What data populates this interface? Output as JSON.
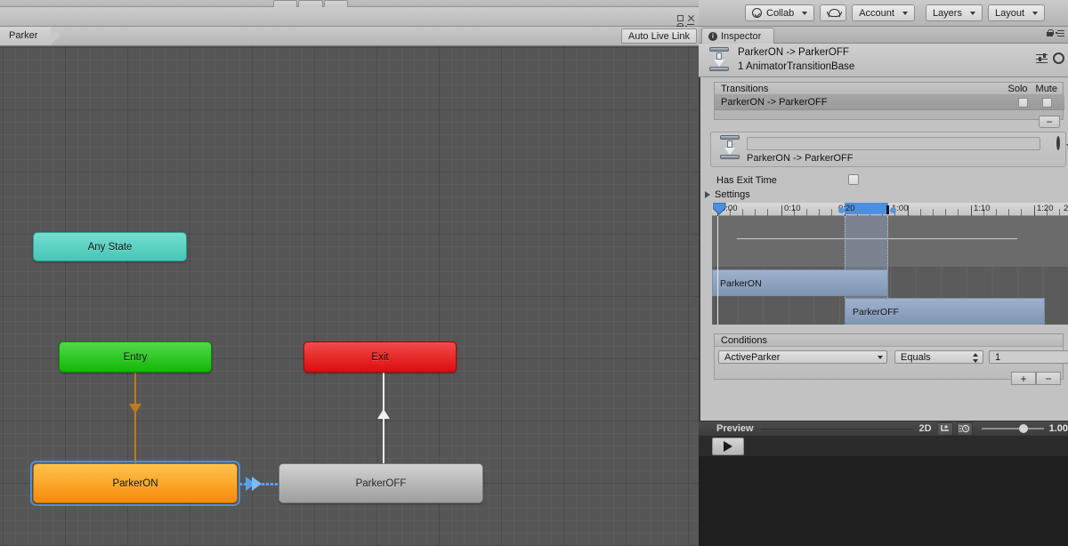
{
  "animator": {
    "breadcrumb": "Parker",
    "auto_live_link": "Auto Live Link",
    "nodes": [
      {
        "name": "Any State",
        "type": "any-state"
      },
      {
        "name": "Entry",
        "type": "entry"
      },
      {
        "name": "Exit",
        "type": "exit"
      },
      {
        "name": "ParkerON",
        "type": "state",
        "selected": true
      },
      {
        "name": "ParkerOFF",
        "type": "state",
        "selected": false
      }
    ],
    "colors": {
      "any_state": "#45c6b6",
      "entry": "#12b806",
      "exit": "#dd0d0d",
      "parker_on": "#f58b09",
      "parker_off": "#9e9e9e",
      "selection": "#4d90dd",
      "transition_link": "#5aa2e8",
      "canvas": "#565656"
    }
  },
  "toolbar": {
    "collab": "Collab",
    "cloud_icon": "cloud-icon",
    "account": "Account",
    "layers": "Layers",
    "layout": "Layout"
  },
  "inspector": {
    "tab": "Inspector",
    "object_title": "ParkerON -> ParkerOFF",
    "object_subtitle": "1 AnimatorTransitionBase",
    "transitions": {
      "header": "Transitions",
      "solo": "Solo",
      "mute": "Mute",
      "rows": [
        {
          "label": "ParkerON -> ParkerOFF",
          "solo": false,
          "mute": false
        }
      ],
      "remove_label": "−"
    },
    "transition_detail": {
      "name_value": "",
      "name_placeholder": "",
      "sub_label": "ParkerON -> ParkerOFF"
    },
    "has_exit_time": {
      "label": "Has Exit Time",
      "checked": false
    },
    "settings_foldout": "Settings",
    "timeline": {
      "ticks": [
        "0:00",
        "0:10",
        "0:20",
        "1:00",
        "1:10",
        "1:20",
        "2"
      ],
      "clips": [
        {
          "label": "ParkerON"
        },
        {
          "label": "ParkerOFF"
        }
      ]
    },
    "conditions": {
      "header": "Conditions",
      "rows": [
        {
          "parameter": "ActiveParker",
          "operator": "Equals",
          "value": "1"
        }
      ],
      "add_label": "+",
      "remove_label": "−"
    },
    "preview": {
      "label": "Preview",
      "mode_2d": "2D",
      "pivot_icon": "pivot-icon",
      "speed_icon": "playback-speed-icon",
      "speed_value": "1.00",
      "play_icon": "play-icon"
    }
  }
}
